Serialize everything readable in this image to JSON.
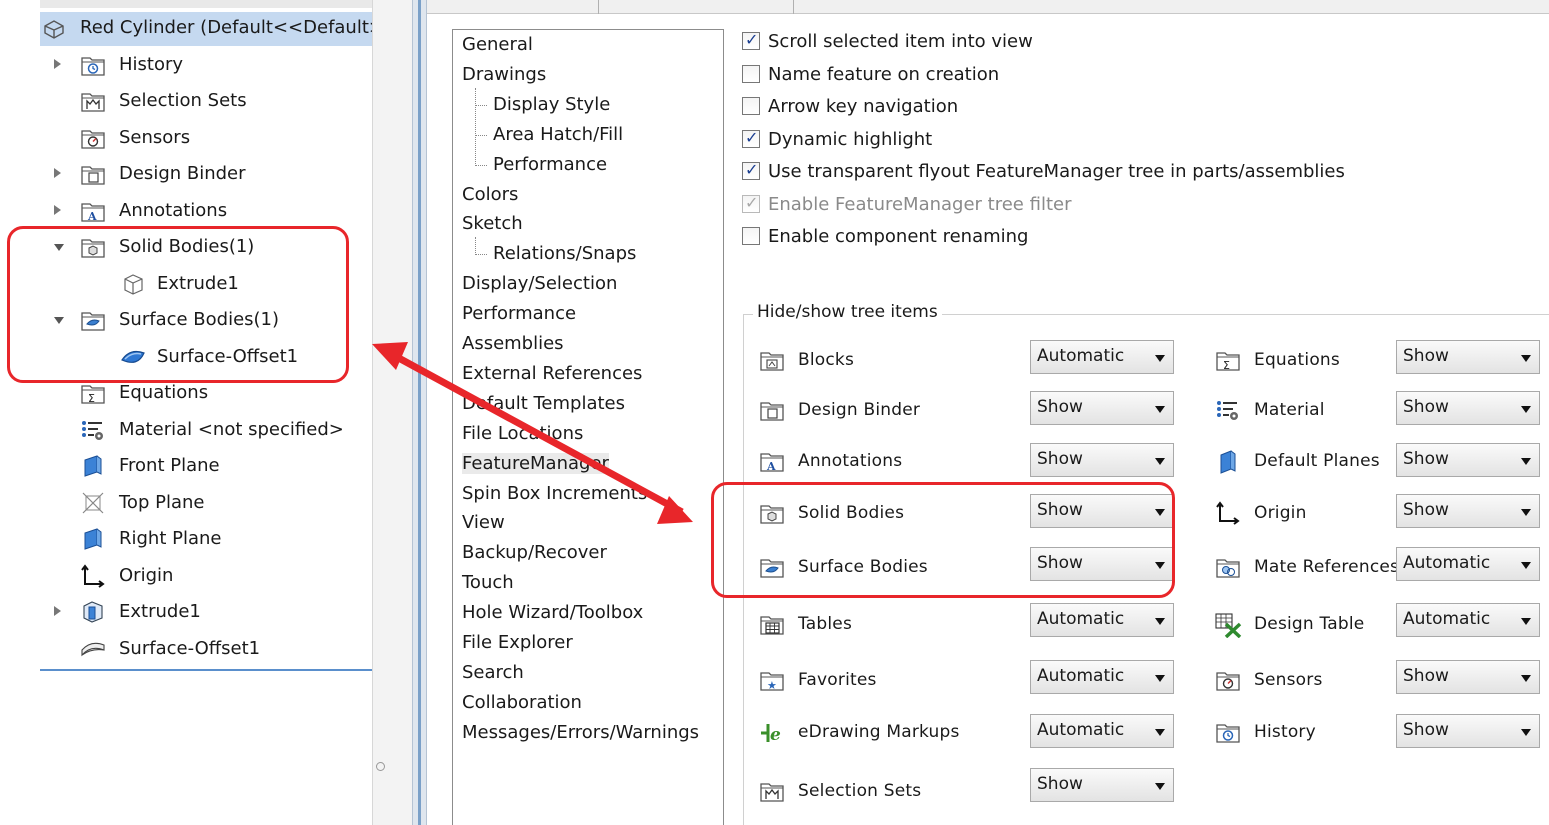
{
  "feature_tree": {
    "root": "Red Cylinder  (Default<<Default>",
    "items": [
      {
        "label": "History",
        "icon": "history-icon",
        "expander": "collapsed"
      },
      {
        "label": "Selection Sets",
        "icon": "selection-sets-icon",
        "expander": ""
      },
      {
        "label": "Sensors",
        "icon": "sensors-icon",
        "expander": ""
      },
      {
        "label": "Design Binder",
        "icon": "design-binder-icon",
        "expander": "collapsed"
      },
      {
        "label": "Annotations",
        "icon": "annotations-icon",
        "expander": "collapsed"
      },
      {
        "label": "Solid Bodies(1)",
        "icon": "solid-bodies-folder-icon",
        "expander": "expanded"
      },
      {
        "label": "Extrude1",
        "icon": "solid-body-icon",
        "expander": ""
      },
      {
        "label": "Surface Bodies(1)",
        "icon": "surface-bodies-folder-icon",
        "expander": "expanded"
      },
      {
        "label": "Surface-Offset1",
        "icon": "surface-body-icon",
        "expander": ""
      },
      {
        "label": "Equations",
        "icon": "equations-icon",
        "expander": ""
      },
      {
        "label": "Material <not specified>",
        "icon": "material-icon",
        "expander": ""
      },
      {
        "label": "Front Plane",
        "icon": "plane-icon",
        "expander": ""
      },
      {
        "label": "Top Plane",
        "icon": "plane-icon",
        "expander": ""
      },
      {
        "label": "Right Plane",
        "icon": "plane-icon",
        "expander": ""
      },
      {
        "label": "Origin",
        "icon": "origin-icon",
        "expander": ""
      },
      {
        "label": "Extrude1",
        "icon": "extrude-feature-icon",
        "expander": "collapsed"
      },
      {
        "label": "Surface-Offset1",
        "icon": "surface-offset-feature-icon",
        "expander": ""
      }
    ]
  },
  "dialog": {
    "tabs": [
      "",
      ""
    ],
    "categories": [
      {
        "label": "General",
        "level": 0
      },
      {
        "label": "Drawings",
        "level": 0
      },
      {
        "label": "Display Style",
        "level": 1
      },
      {
        "label": "Area Hatch/Fill",
        "level": 1
      },
      {
        "label": "Performance",
        "level": 1
      },
      {
        "label": "Colors",
        "level": 0
      },
      {
        "label": "Sketch",
        "level": 0
      },
      {
        "label": "Relations/Snaps",
        "level": 1
      },
      {
        "label": "Display/Selection",
        "level": 0
      },
      {
        "label": "Performance",
        "level": 0
      },
      {
        "label": "Assemblies",
        "level": 0
      },
      {
        "label": "External References",
        "level": 0
      },
      {
        "label": "Default Templates",
        "level": 0
      },
      {
        "label": "File Locations",
        "level": 0
      },
      {
        "label": "FeatureManager",
        "level": 0,
        "selected": true
      },
      {
        "label": "Spin Box Increments",
        "level": 0
      },
      {
        "label": "View",
        "level": 0
      },
      {
        "label": "Backup/Recover",
        "level": 0
      },
      {
        "label": "Touch",
        "level": 0
      },
      {
        "label": "Hole Wizard/Toolbox",
        "level": 0
      },
      {
        "label": "File Explorer",
        "level": 0
      },
      {
        "label": "Search",
        "level": 0
      },
      {
        "label": "Collaboration",
        "level": 0
      },
      {
        "label": "Messages/Errors/Warnings",
        "level": 0
      }
    ],
    "checkboxes": [
      {
        "label": "Scroll selected item into view",
        "checked": true,
        "enabled": true
      },
      {
        "label": "Name feature on creation",
        "checked": false,
        "enabled": true
      },
      {
        "label": "Arrow key navigation",
        "checked": false,
        "enabled": true
      },
      {
        "label": "Dynamic highlight",
        "checked": true,
        "enabled": true
      },
      {
        "label": "Use transparent flyout FeatureManager tree in parts/assemblies",
        "checked": true,
        "enabled": true
      },
      {
        "label": "Enable FeatureManager tree filter",
        "checked": true,
        "enabled": false
      },
      {
        "label": "Enable component renaming",
        "checked": false,
        "enabled": true
      }
    ],
    "group_title": "Hide/show tree items",
    "tree_items_left": [
      {
        "label": "Blocks",
        "icon": "blocks-icon",
        "value": "Automatic"
      },
      {
        "label": "Design Binder",
        "icon": "design-binder-icon",
        "value": "Show"
      },
      {
        "label": "Annotations",
        "icon": "annotations-icon",
        "value": "Show"
      },
      {
        "label": "Solid Bodies",
        "icon": "solid-bodies-icon",
        "value": "Show"
      },
      {
        "label": "Surface Bodies",
        "icon": "surface-bodies-icon",
        "value": "Show"
      },
      {
        "label": "Tables",
        "icon": "tables-icon",
        "value": "Automatic"
      },
      {
        "label": "Favorites",
        "icon": "favorites-icon",
        "value": "Automatic"
      },
      {
        "label": "eDrawing Markups",
        "icon": "edrawing-markups-icon",
        "value": "Automatic"
      },
      {
        "label": "Selection Sets",
        "icon": "selection-sets-icon",
        "value": "Show"
      }
    ],
    "tree_items_right": [
      {
        "label": "Equations",
        "icon": "equations-icon",
        "value": "Show"
      },
      {
        "label": "Material",
        "icon": "material-icon",
        "value": "Show"
      },
      {
        "label": "Default Planes",
        "icon": "default-planes-icon",
        "value": "Show"
      },
      {
        "label": "Origin",
        "icon": "origin-icon",
        "value": "Show"
      },
      {
        "label": "Mate References",
        "icon": "mate-references-icon",
        "value": "Automatic"
      },
      {
        "label": "Design Table",
        "icon": "design-table-icon",
        "value": "Automatic"
      },
      {
        "label": "Sensors",
        "icon": "sensors-icon",
        "value": "Show"
      },
      {
        "label": "History",
        "icon": "history-icon",
        "value": "Show"
      }
    ]
  },
  "colors": {
    "highlight": "#e8262a",
    "selection": "#c5d9f0",
    "check": "#1b3f91"
  }
}
